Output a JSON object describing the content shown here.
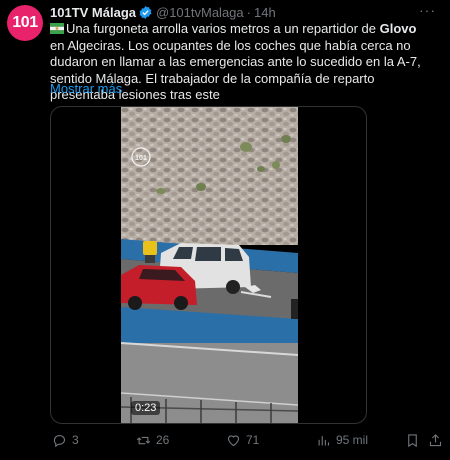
{
  "author": {
    "avatar_text": "101",
    "name": "101TV Málaga",
    "handle": "@101tvMalaga",
    "separator": "·",
    "time": "14h"
  },
  "more_menu": "···",
  "text": {
    "flag_icon": "andalusia-flag-icon",
    "part1": "Una furgoneta arrolla varios metros a un repartidor de ",
    "bold1": "Glovo",
    "part2": " en Algeciras. Los ocupantes de los coches que había cerca no dudaron en llamar a las emergencias ante lo sucedido en la A-7, sentido Málaga. El trabajador de la compañía de reparto presentaba lesiones tras este"
  },
  "show_more": "Mostrar más",
  "media": {
    "watermark": "101",
    "duration": "0:23"
  },
  "actions": {
    "replies": "3",
    "reposts": "26",
    "likes": "71",
    "views": "95 mil"
  },
  "colors": {
    "accent": "#1d9bf0",
    "avatar": "#e8236b",
    "muted": "#71767b"
  }
}
